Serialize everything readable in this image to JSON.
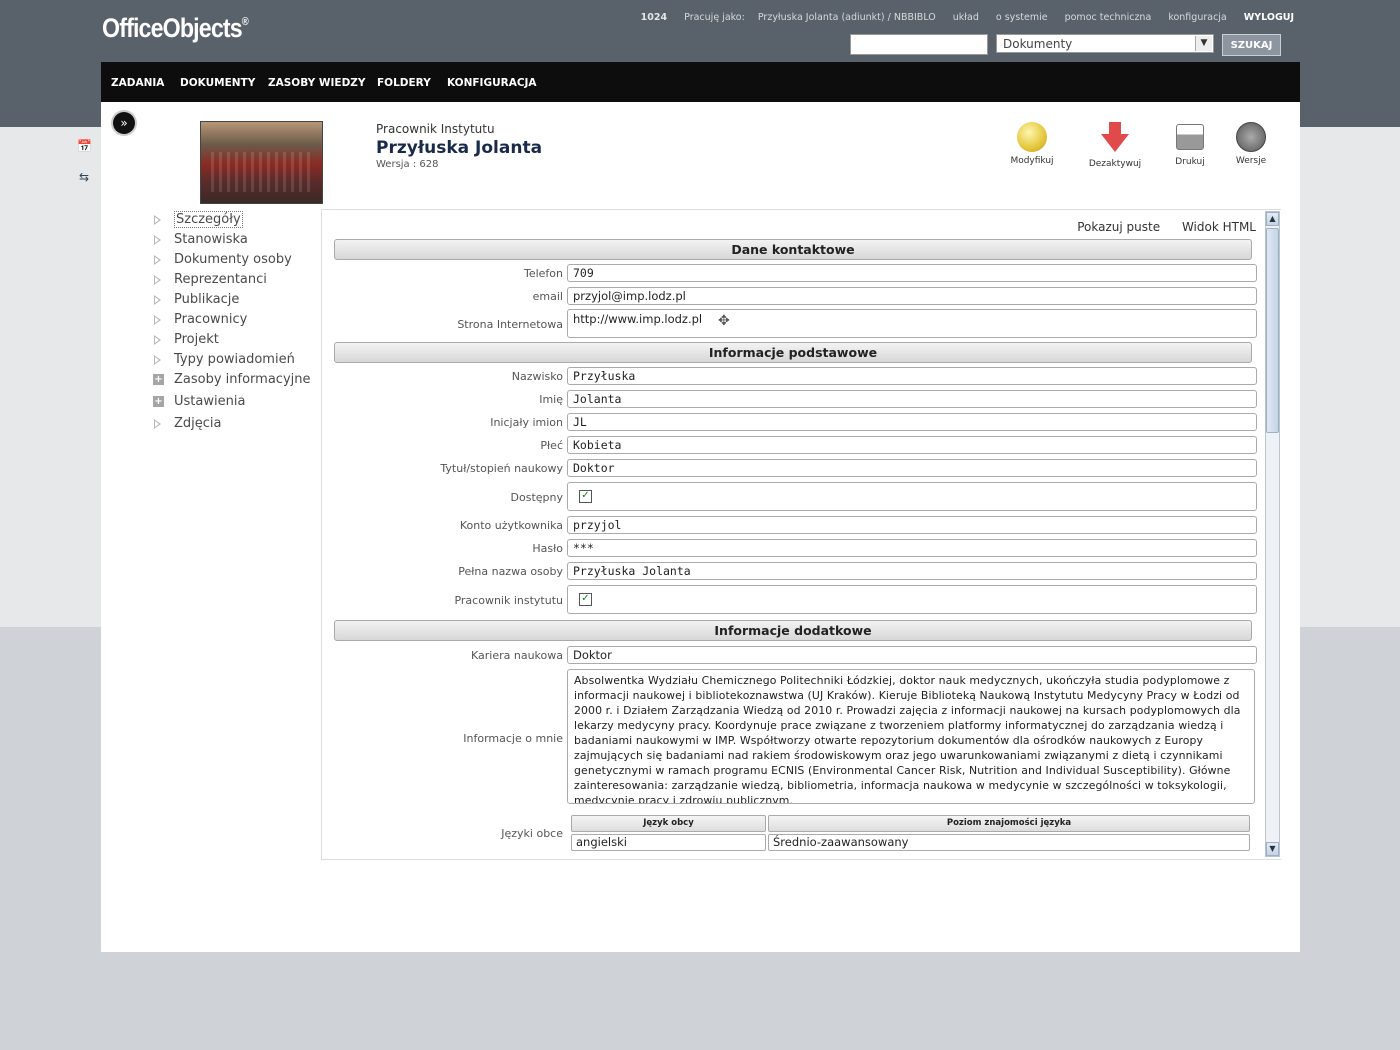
{
  "app": {
    "logo": "OfficeObjects",
    "logo_mark": "®"
  },
  "toplinks": {
    "number": "1024",
    "working_as_label": "Pracuję jako:",
    "working_as_user": "Przyłuska Jolanta (adiunkt) / NBBIBLO",
    "layout": "układ",
    "about": "o systemie",
    "support": "pomoc techniczna",
    "config": "konfiguracja",
    "logout": "WYLOGUJ"
  },
  "search": {
    "input_value": "",
    "scope_selected": "Dokumenty",
    "button_label": "SZUKAJ"
  },
  "nav": [
    "ZADANIA",
    "DOKUMENTY",
    "ZASOBY WIEDZY",
    "FOLDERY",
    "KONFIGURACJA"
  ],
  "record": {
    "type": "Pracownik Instytutu",
    "name": "Przyłuska Jolanta",
    "version": "Wersja : 628"
  },
  "actions": {
    "modify": "Modyfikuj",
    "deactivate": "Dezaktywuj",
    "print": "Drukuj",
    "versions": "Wersje"
  },
  "tree": [
    {
      "label": "Szczegóły",
      "type": "arrow",
      "selected": true
    },
    {
      "label": "Stanowiska",
      "type": "arrow"
    },
    {
      "label": "Dokumenty osoby",
      "type": "arrow"
    },
    {
      "label": "Reprezentanci",
      "type": "arrow"
    },
    {
      "label": "Publikacje",
      "type": "arrow"
    },
    {
      "label": "Pracownicy",
      "type": "arrow"
    },
    {
      "label": "Projekt",
      "type": "arrow"
    },
    {
      "label": "Typy powiadomień",
      "type": "arrow"
    },
    {
      "label": "Zasoby informacyjne",
      "type": "plus"
    },
    {
      "label": "Ustawienia",
      "type": "plus"
    },
    {
      "label": "Zdjęcia",
      "type": "arrow"
    }
  ],
  "panel": {
    "show_empty": "Pokazuj puste",
    "html_view": "Widok HTML",
    "sections": {
      "contact": "Dane kontaktowe",
      "basic": "Informacje podstawowe",
      "extra": "Informacje dodatkowe"
    },
    "contact": {
      "phone_label": "Telefon",
      "phone": "709",
      "email_label": "email",
      "email": "przyjol@imp.lodz.pl",
      "www_label": "Strona Internetowa",
      "www": "http://www.imp.lodz.pl"
    },
    "basic": {
      "surname_label": "Nazwisko",
      "surname": "Przyłuska",
      "firstname_label": "Imię",
      "firstname": "Jolanta",
      "initials_label": "Inicjały imion",
      "initials": "JL",
      "gender_label": "Płeć",
      "gender": "Kobieta",
      "title_label": "Tytuł/stopień naukowy",
      "title": "Doktor",
      "available_label": "Dostępny",
      "available": true,
      "account_label": "Konto użytkownika",
      "account": "przyjol",
      "password_label": "Hasło",
      "password": "***",
      "fullname_label": "Pełna nazwa osoby",
      "fullname": "Przyłuska Jolanta",
      "employee_label": "Pracownik instytutu",
      "employee": true
    },
    "extra": {
      "career_label": "Kariera naukowa",
      "career": "Doktor",
      "about_label": "Informacje o mnie",
      "about": "Absolwentka Wydziału Chemicznego Politechniki Łódzkiej, doktor nauk medycznych, ukończyła studia podyplomowe z informacji naukowej i bibliotekoznawstwa (UJ Kraków). Kieruje Biblioteką Naukową Instytutu Medycyny Pracy w Łodzi od 2000 r. i Działem Zarządzania Wiedzą od 2010 r. Prowadzi zajęcia z informacji naukowej na kursach podyplomowych dla lekarzy medycyny pracy. Koordynuje prace związane z tworzeniem platformy informatycznej do zarządzania wiedzą i badaniami naukowymi w IMP. Współtworzy otwarte repozytorium dokumentów dla ośrodków naukowych z Europy zajmujących się badaniami nad rakiem środowiskowym oraz jego uwarunkowaniami związanymi z dietą i czynnikami genetycznymi w ramach programu ECNIS (Environmental Cancer Risk, Nutrition and Individual Susceptibility). Główne zainteresowania: zarządzanie wiedzą, bibliometria, informacja naukowa w medycynie w szczególności w toksykologii, medycynie pracy i zdrowiu publicznym.",
      "languages_label": "Języki obce",
      "lang_col1": "Język obcy",
      "lang_col2": "Poziom znajomości języka",
      "languages": [
        {
          "language": "angielski",
          "level": "Średnio-zaawansowany"
        }
      ]
    }
  }
}
